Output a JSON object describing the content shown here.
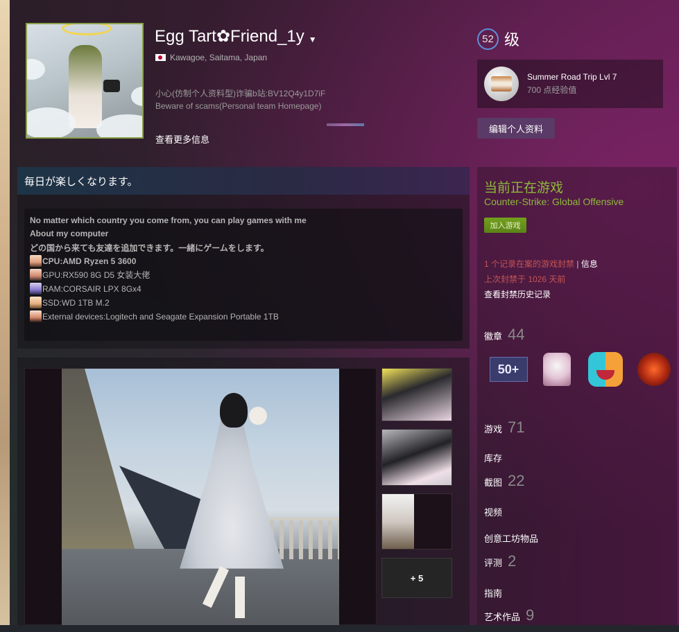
{
  "profile": {
    "name": "Egg Tart✿Friend_1y",
    "location": "Kawagoe, Saitama, Japan",
    "summary_line1": "小心(仿制个人资料型)诈骗b站:BV12Q4y1D7iF",
    "summary_line2": "Beware of scams(Personal team Homepage)",
    "more_info": "查看更多信息"
  },
  "level": {
    "value": "52",
    "label": "级"
  },
  "featured_badge": {
    "title": "Summer Road Trip Lvl 7",
    "xp": "700 点经验值"
  },
  "edit_profile": "编辑个人资料",
  "summary_panel": {
    "title": "毎日が楽しくなります。",
    "lines": [
      "No matter which country you come from, you can play games with me",
      "About my computer",
      "どの国から来ても友達を追加できます。一緒にゲームをします。",
      "CPU:AMD Ryzen 5 3600",
      "GPU:RX590 8G D5 女装大佬",
      "RAM:CORSAIR LPX 8Gx4",
      "SSD:WD 1TB M.2",
      "External devices:Logitech and Seagate Expansion Portable 1TB"
    ]
  },
  "showcase": {
    "more_label": "+ 5"
  },
  "in_game": {
    "title": "当前正在游戏",
    "game": "Counter-Strike: Global Offensive",
    "join": "加入游戏"
  },
  "bans": {
    "line1": "1 个记录在案的游戏封禁",
    "sep": " | ",
    "info": "信息",
    "line2": "上次封禁于 1026 天前",
    "history": "查看封禁历史记录"
  },
  "stats": {
    "badges_label": "徽章",
    "badges_count": "44",
    "badge_50_label": "50+",
    "games_label": "游戏",
    "games_count": "71",
    "inventory_label": "库存",
    "screenshots_label": "截图",
    "screenshots_count": "22",
    "videos_label": "视频",
    "workshop_label": "创意工坊物品",
    "reviews_label": "评测",
    "reviews_count": "2",
    "guides_label": "指南",
    "artwork_label": "艺术作品",
    "artwork_count": "9"
  },
  "colors": {
    "in_game_green": "#8fb93b",
    "ban_red": "#c55454",
    "level_ring": "#5d8ed8",
    "edit_button": "#5a3a66"
  }
}
